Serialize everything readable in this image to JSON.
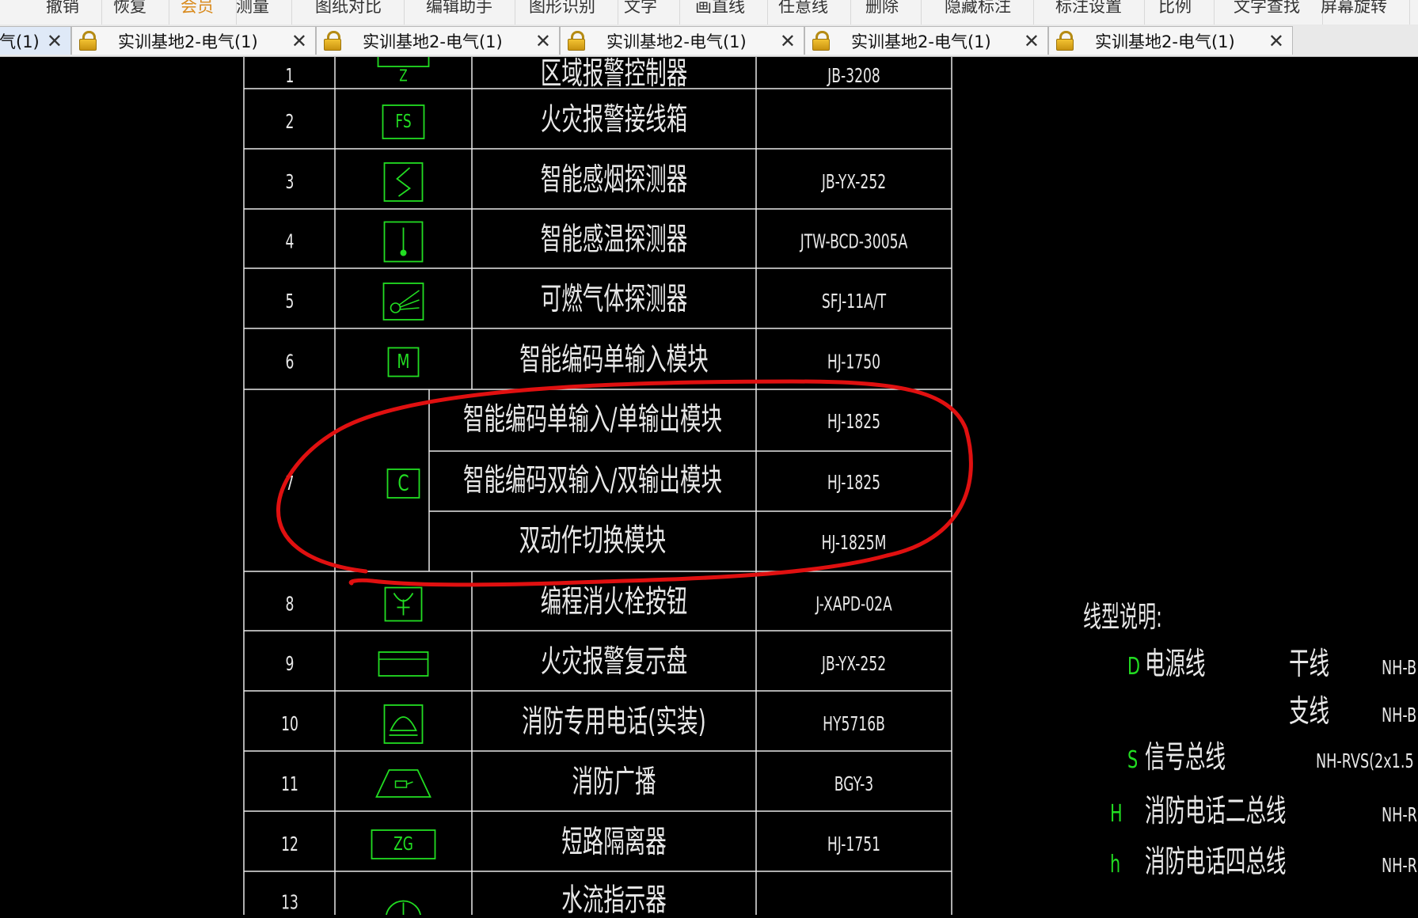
{
  "toolbar": {
    "items": [
      {
        "label": "撤销",
        "accent": false
      },
      {
        "label": "恢复",
        "accent": false
      },
      {
        "label": "会员",
        "accent": true
      },
      {
        "label": "测量",
        "accent": false
      },
      {
        "label": "图纸对比",
        "accent": false
      },
      {
        "label": "编辑助手",
        "accent": false
      },
      {
        "label": "图形识别",
        "accent": false
      },
      {
        "label": "文字",
        "accent": false
      },
      {
        "label": "画直线",
        "accent": false
      },
      {
        "label": "任意线",
        "accent": false
      },
      {
        "label": "删除",
        "accent": false
      },
      {
        "label": "隐藏标注",
        "accent": false
      },
      {
        "label": "标注设置",
        "accent": false
      },
      {
        "label": "比例",
        "accent": false
      },
      {
        "label": "文字查找",
        "accent": false
      },
      {
        "label": "屏幕旋转",
        "accent": false
      }
    ]
  },
  "tabs": [
    {
      "label": "气(1)",
      "locked": false,
      "active": true
    },
    {
      "label": "实训基地2-电气(1)",
      "locked": true,
      "active": false
    },
    {
      "label": "实训基地2-电气(1)",
      "locked": true,
      "active": false
    },
    {
      "label": "实训基地2-电气(1)",
      "locked": true,
      "active": false
    },
    {
      "label": "实训基地2-电气(1)",
      "locked": true,
      "active": false
    },
    {
      "label": "实训基地2-电气(1)",
      "locked": true,
      "active": false
    }
  ],
  "tab_close_glyph": "✕",
  "table": {
    "rows": [
      {
        "num": "1",
        "symbol": "Z",
        "name": "区域报警控制器",
        "model": "JB-3208"
      },
      {
        "num": "2",
        "symbol": "FS",
        "name": "火灾报警接线箱",
        "model": ""
      },
      {
        "num": "3",
        "symbol": "smoke-detector",
        "name": "智能感烟探测器",
        "model": "JB-YX-252"
      },
      {
        "num": "4",
        "symbol": "heat-detector",
        "name": "智能感温探测器",
        "model": "JTW-BCD-3005A"
      },
      {
        "num": "5",
        "symbol": "gas-detector",
        "name": "可燃气体探测器",
        "model": "SFJ-11A/T"
      },
      {
        "num": "6",
        "symbol": "M",
        "name": "智能编码单输入模块",
        "model": "HJ-1750"
      },
      {
        "num": "7",
        "symbol": "C",
        "subrows": [
          {
            "name": "智能编码单输入/单输出模块",
            "model": "HJ-1825"
          },
          {
            "name": "智能编码双输入/双输出模块",
            "model": "HJ-1825"
          },
          {
            "name": "双动作切换模块",
            "model": "HJ-1825M"
          }
        ]
      },
      {
        "num": "8",
        "symbol": "hydrant-button",
        "name": "编程消火栓按钮",
        "model": "J-XAPD-02A"
      },
      {
        "num": "9",
        "symbol": "repeater-panel",
        "name": "火灾报警复示盘",
        "model": "JB-YX-252"
      },
      {
        "num": "10",
        "symbol": "phone",
        "name": "消防专用电话(实装)",
        "model": "HY5716B"
      },
      {
        "num": "11",
        "symbol": "speaker",
        "name": "消防广播",
        "model": "BGY-3"
      },
      {
        "num": "12",
        "symbol": "ZG",
        "name": "短路隔离器",
        "model": "HJ-1751"
      },
      {
        "num": "13",
        "symbol": "flow-indicator",
        "name": "水流指示器",
        "model": ""
      }
    ]
  },
  "legend": {
    "title": "线型说明:",
    "items": [
      {
        "code": "D",
        "name": "电源线",
        "type": "干线",
        "spec": "NH-B"
      },
      {
        "code": "",
        "name": "",
        "type": "支线",
        "spec": "NH-B"
      },
      {
        "code": "S",
        "name": "信号总线",
        "type": "",
        "spec": "NH-RVS(2x1.5"
      },
      {
        "code": "H",
        "name": "消防电话二总线",
        "type": "",
        "spec": "NH-R"
      },
      {
        "code": "h",
        "name": "消防电话四总线",
        "type": "",
        "spec": "NH-R"
      }
    ]
  },
  "colors": {
    "background": "#000000",
    "grid": "#e8e8e8",
    "symbol": "#22dd22",
    "annotation": "#e01010"
  }
}
